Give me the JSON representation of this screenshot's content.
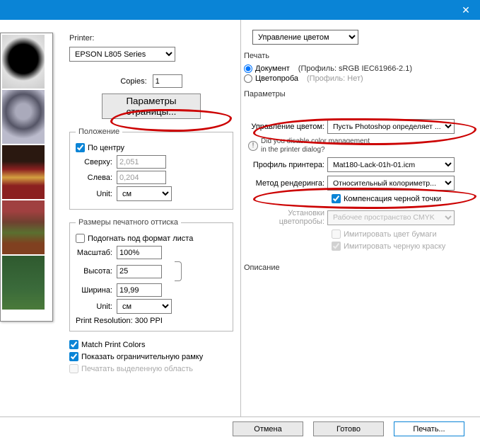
{
  "titlebar": {
    "close_glyph": "✕"
  },
  "left": {
    "printer_label": "Printer:",
    "printer_selected": "EPSON L805 Series",
    "copies_label": "Copies:",
    "copies_value": "1",
    "page_params_btn": "Параметры страницы...",
    "position": {
      "legend": "Положение",
      "center_chk": "По центру",
      "top_label": "Сверху:",
      "top_value": "2,051",
      "left_label": "Слева:",
      "left_value": "0,204",
      "unit_label": "Unit:",
      "unit_value": "см"
    },
    "printsize": {
      "legend": "Размеры печатного оттиска",
      "fit_chk": "Подогнать под формат листа",
      "scale_label": "Масштаб:",
      "scale_value": "100%",
      "height_label": "Высота:",
      "height_value": "25",
      "width_label": "Ширина:",
      "width_value": "19,99",
      "unit_label": "Unit:",
      "unit_value": "см",
      "resolution_label": "Print Resolution: 300 PPI"
    },
    "match_colors_chk": "Match Print Colors",
    "bounding_chk": "Показать ограничительную рамку",
    "print_sel_chk": "Печатать выделенную область"
  },
  "right": {
    "top_select": "Управление цветом",
    "print_heading": "Печать",
    "doc_radio": "Документ",
    "doc_profile": "(Профиль: sRGB IEC61966-2.1)",
    "proof_radio": "Цветопроба",
    "proof_profile": "(Профиль: Нет)",
    "params_heading": "Параметры",
    "color_handling_label": "Управление цветом:",
    "color_handling_value": "Пусть Photoshop определяет ...",
    "warning_line1": "Did you disable color management",
    "warning_line2": "in the printer dialog?",
    "printer_profile_label": "Профиль принтера:",
    "printer_profile_value": "Mat180-Lack-01h-01.icm",
    "render_intent_label": "Метод рендеринга:",
    "render_intent_value": "Относительный колориметр...",
    "black_point_chk": "Компенсация черной точки",
    "proof_setup_label": "Установки цветопробы:",
    "proof_setup_value": "Рабочее пространство CMYK",
    "sim_paper_chk": "Имитировать цвет бумаги",
    "sim_black_chk": "Имитировать черную краску",
    "description_heading": "Описание"
  },
  "buttons": {
    "cancel": "Отмена",
    "done": "Готово",
    "print": "Печать..."
  }
}
